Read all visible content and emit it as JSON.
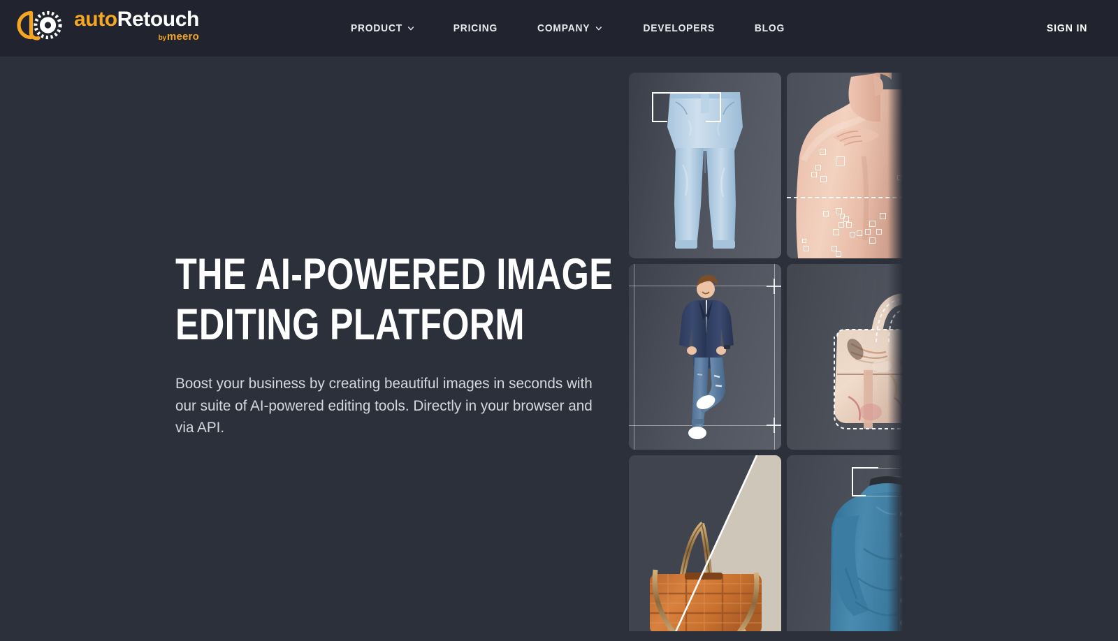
{
  "brand": {
    "logo_icon": "autoretouch-aperture-logo",
    "name_prefix": "auto",
    "name_suffix": "Retouch",
    "byline_prefix": "by",
    "byline_name": "meero",
    "accent_color": "#f5a623"
  },
  "header": {
    "background_color": "#21242e",
    "nav_items": [
      {
        "label": "PRODUCT",
        "has_dropdown": true,
        "icon": "chevron-down-icon"
      },
      {
        "label": "PRICING",
        "has_dropdown": false,
        "icon": ""
      },
      {
        "label": "COMPANY",
        "has_dropdown": true,
        "icon": "chevron-down-icon"
      },
      {
        "label": "DEVELOPERS",
        "has_dropdown": false,
        "icon": ""
      },
      {
        "label": "BLOG",
        "has_dropdown": false,
        "icon": ""
      }
    ],
    "sign_in_label": "SIGN IN"
  },
  "hero": {
    "title": "THE AI-POWERED IMAGE EDITING PLATFORM",
    "subtitle": "Boost your business by creating beautiful images in seconds with our suite of AI-powered editing tools. Directly in your browser and via API.",
    "title_color": "#ffffff",
    "subtitle_color": "#d5d8dd",
    "background_color": "#2c303a"
  },
  "showcase": {
    "tiles": [
      {
        "id": "tile-jeans",
        "subject": "light-blue-jeans",
        "overlay": "crop-bracket"
      },
      {
        "id": "tile-skin",
        "subject": "bare-back-skin-retouch",
        "overlay": "blemish-markers-and-dashed-divider"
      },
      {
        "id": "tile-man",
        "subject": "man-jumping-navy-blazer",
        "overlay": "alignment-guides-and-crosshairs"
      },
      {
        "id": "tile-bag1",
        "subject": "floral-print-handbag",
        "overlay": "dashed-cutout-selection"
      },
      {
        "id": "tile-bag2",
        "subject": "orange-woven-chain-bag",
        "overlay": "diagonal-before-after-split"
      },
      {
        "id": "tile-shirt",
        "subject": "blue-chambray-shirt",
        "overlay": "crop-bracket"
      }
    ]
  }
}
